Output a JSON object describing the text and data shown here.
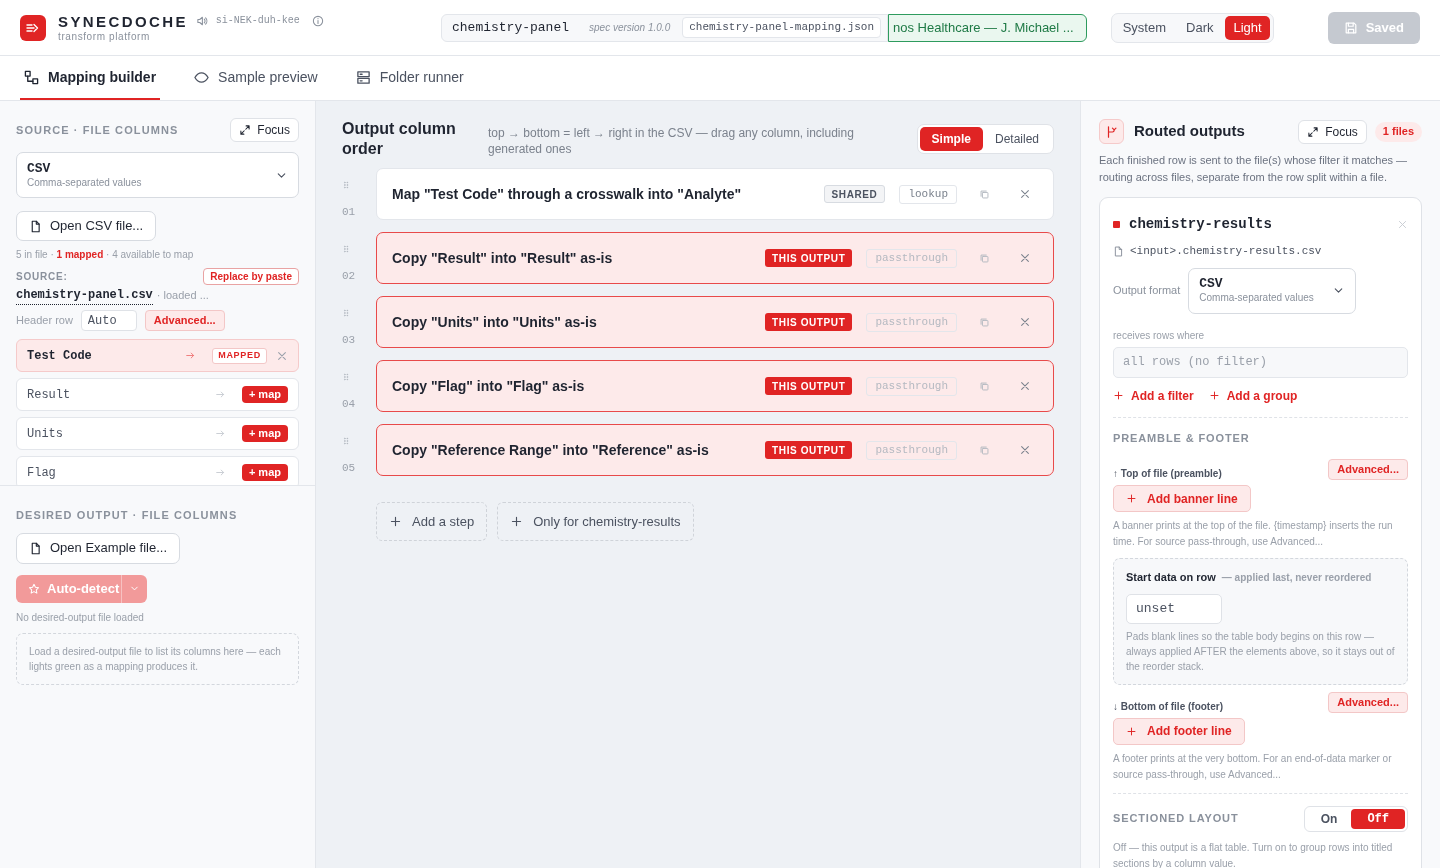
{
  "header": {
    "brand": {
      "name": "SYNECDOCHE",
      "subtitle": "transform platform",
      "pronunciation": "si-NEK-duh-kee"
    },
    "spec": {
      "name": "chemistry-panel",
      "version": "spec version 1.0.0",
      "file": "chemistry-panel-mapping.json",
      "owner": "nos Healthcare — J. Michael ..."
    },
    "theme": [
      {
        "label": "System",
        "selected": false
      },
      {
        "label": "Dark",
        "selected": false
      },
      {
        "label": "Light",
        "selected": true
      }
    ],
    "save_button": {
      "label": "Saved",
      "disabled": true
    }
  },
  "tabs": [
    {
      "label": "Mapping builder",
      "selected": true
    },
    {
      "label": "Sample preview",
      "selected": false
    },
    {
      "label": "Folder runner",
      "selected": false
    }
  ],
  "source_panel": {
    "heading": "SOURCE · FILE COLUMNS",
    "focus_label": "Focus",
    "format": {
      "name": "CSV",
      "description": "Comma-separated values"
    },
    "open_button": "Open CSV file...",
    "counts": [
      {
        "text": "5 in file ·",
        "highlight": false
      },
      {
        "text": "1 mapped",
        "highlight": true
      },
      {
        "text": "· 4 available to map",
        "highlight": false
      }
    ],
    "source_label": "SOURCE:",
    "replace_button": "Replace by paste",
    "file_name": "chemistry-panel.csv",
    "file_status": "· loaded ...",
    "header_row_label": "Header row",
    "header_row_value": "Auto",
    "advanced_button": "Advanced...",
    "columns": [
      {
        "name": "Test Code",
        "mapped": true,
        "tag": "MAPPED"
      },
      {
        "name": "Result",
        "mapped": false,
        "tag": "+ map"
      },
      {
        "name": "Units",
        "mapped": false,
        "tag": "+ map"
      },
      {
        "name": "Flag",
        "mapped": false,
        "tag": "+ map"
      }
    ]
  },
  "desired_panel": {
    "heading": "DESIRED OUTPUT · FILE COLUMNS",
    "open_button": "Open Example file...",
    "autodetect_button": {
      "label": "Auto-detect",
      "disabled": true
    },
    "status": "No desired-output file loaded",
    "empty_hint": "Load a desired-output file to list its columns here — each lights green as a mapping produces it."
  },
  "order_panel": {
    "title": "Output column order",
    "hint": "top → bottom = left → right in the CSV — drag any column, including generated ones",
    "view_modes": [
      {
        "label": "Simple",
        "selected": true
      },
      {
        "label": "Detailed",
        "selected": false
      }
    ],
    "steps": [
      {
        "number": "01",
        "text": "Map \"Test Code\" through a crosswalk into \"Analyte\"",
        "scope": "SHARED",
        "this_output": false,
        "transform": "lookup"
      },
      {
        "number": "02",
        "text": "Copy \"Result\" into \"Result\" as-is",
        "scope": "THIS OUTPUT",
        "this_output": true,
        "transform": "passthrough"
      },
      {
        "number": "03",
        "text": "Copy \"Units\" into \"Units\" as-is",
        "scope": "THIS OUTPUT",
        "this_output": true,
        "transform": "passthrough"
      },
      {
        "number": "04",
        "text": "Copy \"Flag\" into \"Flag\" as-is",
        "scope": "THIS OUTPUT",
        "this_output": true,
        "transform": "passthrough"
      },
      {
        "number": "05",
        "text": "Copy \"Reference Range\" into \"Reference\" as-is",
        "scope": "THIS OUTPUT",
        "this_output": true,
        "transform": "passthrough"
      }
    ],
    "add_buttons": [
      "Add a step",
      "Only for chemistry-results"
    ]
  },
  "routed_panel": {
    "title": "Routed outputs",
    "focus_label": "Focus",
    "count": "1 files",
    "description": "Each finished row is sent to the file(s) whose filter it matches — routing across files, separate from the row split within a file.",
    "output": {
      "name": "chemistry-results",
      "color": "#e02424",
      "path": "<input>.chemistry-results.csv",
      "format_label": "Output format",
      "format": {
        "name": "CSV",
        "description": "Comma-separated values"
      },
      "filter_label": "receives rows where",
      "filter_placeholder": "all rows (no filter)",
      "filter_actions": [
        "Add a filter",
        "Add a group"
      ],
      "preamble_heading": "PREAMBLE & FOOTER",
      "top_label": "↑ Top of file (preamble)",
      "top_advanced": "Advanced...",
      "banner_button": "Add banner line",
      "banner_note": "A banner prints at the top of the file. {timestamp} inserts the run time. For source pass-through, use Advanced...",
      "start_row": {
        "label": "Start data on row",
        "aside": "— applied last, never reordered",
        "placeholder": "unset",
        "description": "Pads blank lines so the table body begins on this row — always applied AFTER the elements above, so it stays out of the reorder stack."
      },
      "bottom_label": "↓ Bottom of file (footer)",
      "bottom_advanced": "Advanced...",
      "footer_button": "Add footer line",
      "footer_note": "A footer prints at the very bottom. For an end-of-data marker or source pass-through, use Advanced...",
      "sectioned": {
        "heading": "SECTIONED LAYOUT",
        "options": [
          {
            "label": "On",
            "selected": false
          },
          {
            "label": "Off",
            "selected": true
          }
        ],
        "note": "Off — this output is a flat table. Turn on to group rows into titled sections by a column value."
      }
    }
  }
}
